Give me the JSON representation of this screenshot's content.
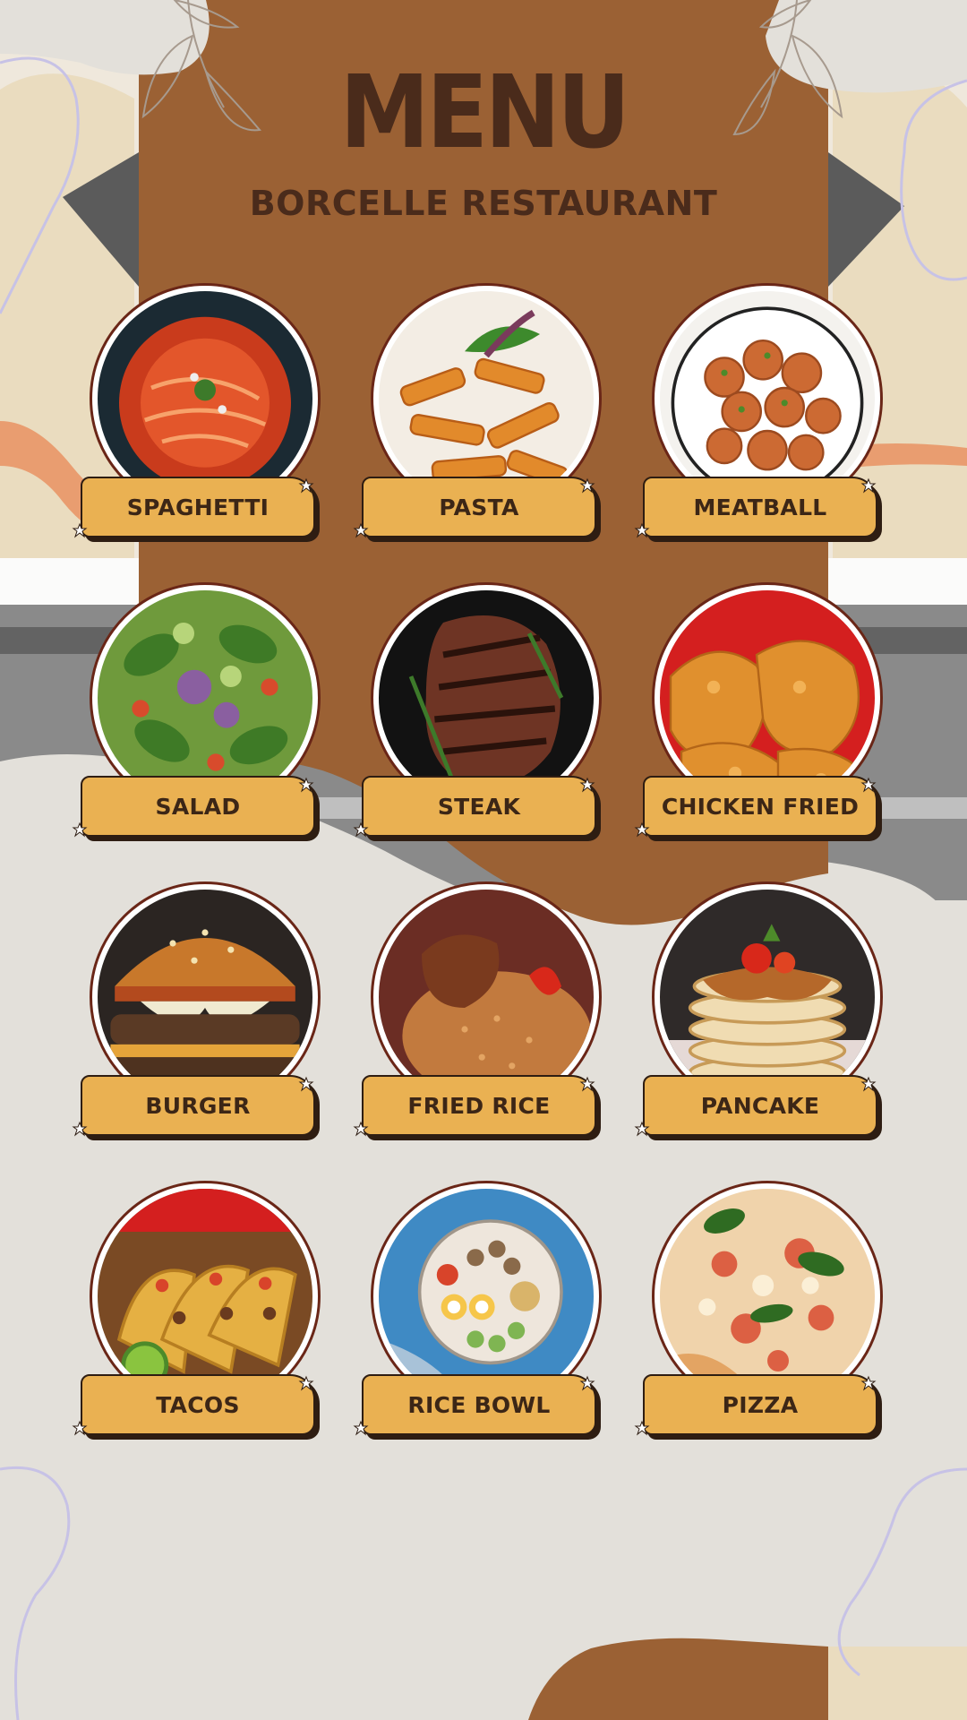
{
  "menu": {
    "title": "MENU",
    "subtitle": "BORCELLE RESTAURANT"
  },
  "items": [
    {
      "label": "SPAGHETTI",
      "icon": "spaghetti-photo"
    },
    {
      "label": "PASTA",
      "icon": "pasta-photo"
    },
    {
      "label": "MEATBALL",
      "icon": "meatball-photo"
    },
    {
      "label": "SALAD",
      "icon": "salad-photo"
    },
    {
      "label": "STEAK",
      "icon": "steak-photo"
    },
    {
      "label": "CHICKEN FRIED",
      "icon": "fried-chicken-photo"
    },
    {
      "label": "BURGER",
      "icon": "burger-photo"
    },
    {
      "label": "FRIED RICE",
      "icon": "fried-rice-photo"
    },
    {
      "label": "PANCAKE",
      "icon": "pancake-photo"
    },
    {
      "label": "TACOS",
      "icon": "tacos-photo"
    },
    {
      "label": "RICE BOWL",
      "icon": "rice-bowl-photo"
    },
    {
      "label": "PIZZA",
      "icon": "pizza-photo"
    }
  ],
  "colors": {
    "brown": "#9b6134",
    "dark_brown": "#4a2b1b",
    "label_fill": "#eab152",
    "background": "#e3e0da"
  }
}
